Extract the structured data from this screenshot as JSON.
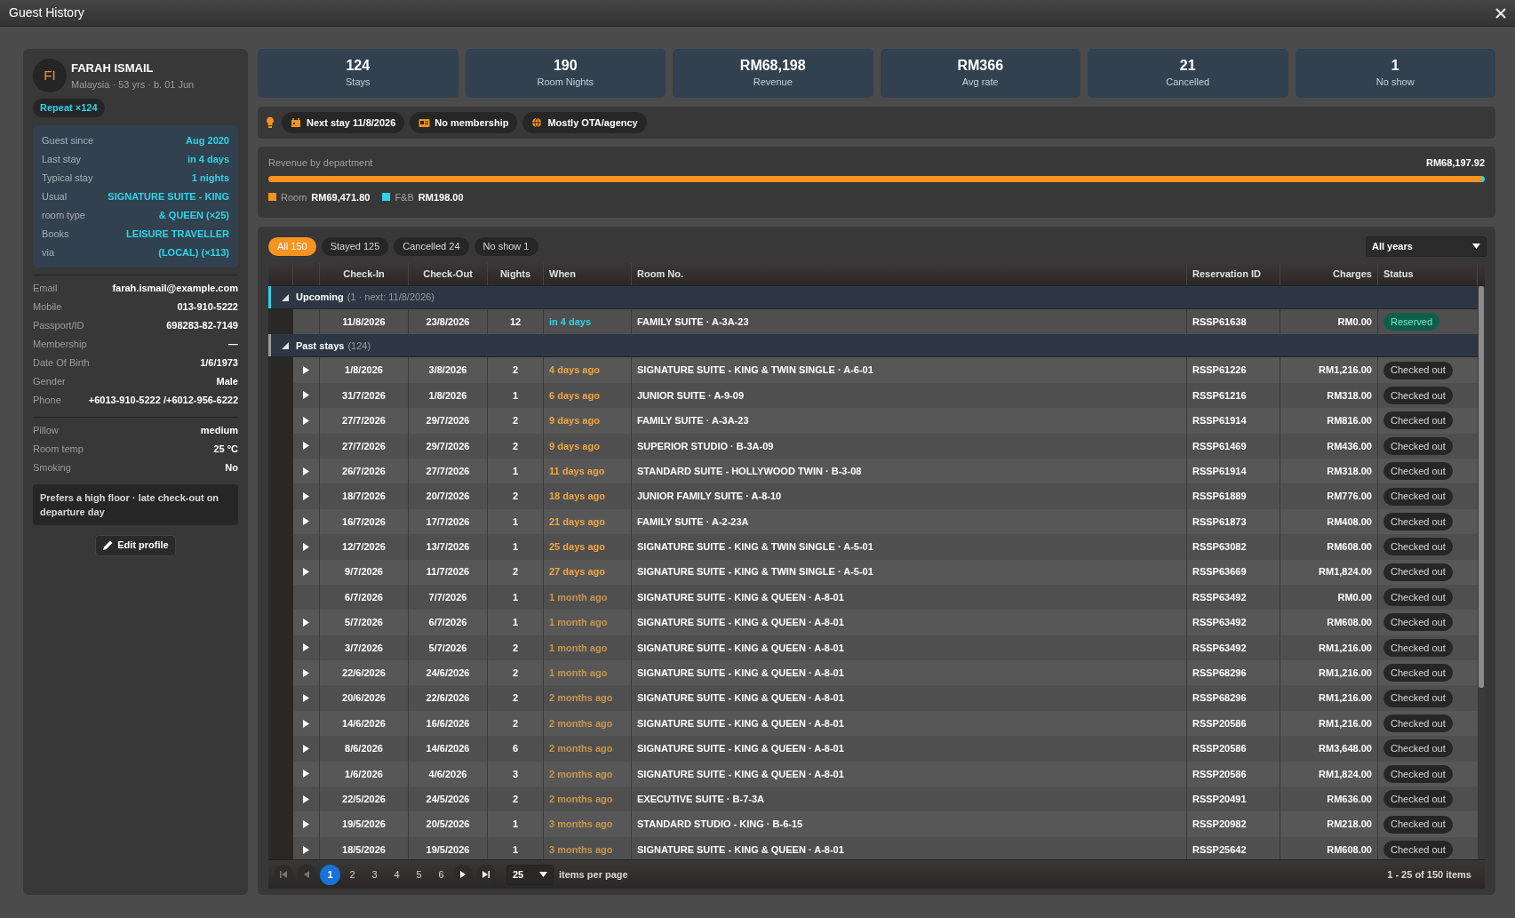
{
  "window": {
    "title": "Guest History"
  },
  "guest": {
    "initials": "FI",
    "name": "FARAH ISMAIL",
    "subtitle": "Malaysia · 53 yrs · b. 01 Jun",
    "badge": "Repeat ×124",
    "summary": [
      {
        "label": "Guest since",
        "value": "Aug 2020"
      },
      {
        "label": "Last stay",
        "value": "in 4 days"
      },
      {
        "label": "Typical stay",
        "value": "1 nights"
      },
      {
        "label": "Usual",
        "value": "SIGNATURE SUITE - KING"
      },
      {
        "label": "room type",
        "value": "& QUEEN (×25)"
      },
      {
        "label": "Books",
        "value": "LEISURE TRAVELLER"
      },
      {
        "label": "via",
        "value": "(LOCAL) (×113)"
      }
    ],
    "contact": [
      {
        "label": "Email",
        "value": "farah.ismail@example.com"
      },
      {
        "label": "Mobile",
        "value": "013-910-5222"
      },
      {
        "label": "Passport/ID",
        "value": "698283-82-7149"
      },
      {
        "label": "Membership",
        "value": "—"
      },
      {
        "label": "Date Of Birth",
        "value": "1/6/1973"
      },
      {
        "label": "Gender",
        "value": "Male"
      },
      {
        "label": "Phone",
        "value": "+6013-910-5222 /+6012-956-6222"
      }
    ],
    "preferences": [
      {
        "label": "Pillow",
        "value": "medium"
      },
      {
        "label": "Room temp",
        "value": "25 °C"
      },
      {
        "label": "Smoking",
        "value": "No"
      }
    ],
    "note": "Prefers a high floor · late check-out on departure day",
    "edit_button": "Edit profile"
  },
  "stats": [
    {
      "value": "124",
      "label": "Stays"
    },
    {
      "value": "190",
      "label": "Room Nights"
    },
    {
      "value": "RM68,198",
      "label": "Revenue"
    },
    {
      "value": "RM366",
      "label": "Avg rate"
    },
    {
      "value": "21",
      "label": "Cancelled"
    },
    {
      "value": "1",
      "label": "No show"
    }
  ],
  "insights": [
    {
      "kind": "calendar",
      "label": "Next stay 11/8/2026"
    },
    {
      "kind": "card",
      "label": "No membership"
    },
    {
      "kind": "globe",
      "label": "Mostly OTA/agency"
    }
  ],
  "revenue": {
    "title": "Revenue by department",
    "total": "RM68,197.92",
    "segments": [
      {
        "label": "Room",
        "value": "RM69,471.80",
        "color": "#f7931e",
        "level": 0.997
      },
      {
        "label": "F&B",
        "value": "RM198.00",
        "color": "#2dd4e6",
        "level": 0.003
      }
    ]
  },
  "filters": [
    {
      "label": "All 150",
      "selected": true
    },
    {
      "label": "Stayed 125",
      "selected": false
    },
    {
      "label": "Cancelled 24",
      "selected": false
    },
    {
      "label": "No show 1",
      "selected": false
    }
  ],
  "year_filter": "All years",
  "table": {
    "columns": [
      {
        "label": "Check-In"
      },
      {
        "label": "Check-Out"
      },
      {
        "label": "Nights"
      },
      {
        "label": "When"
      },
      {
        "label": "Room No."
      },
      {
        "label": "Reservation ID"
      },
      {
        "label": "Charges"
      },
      {
        "label": "Status"
      }
    ],
    "groups": [
      {
        "label": "Upcoming",
        "meta": "(1 · next: 11/8/2026)",
        "expanded": true,
        "color": "#2dd4e6",
        "rows": [
          {
            "expandable": false,
            "check_in": "11/8/2026",
            "check_out": "23/8/2026",
            "nights": "12",
            "when": "in 4 days",
            "color": "#2dd4e6",
            "room": "FAMILY SUITE · A-3A-23",
            "reservation_id": "RSSP61638",
            "charges": "RM0.00",
            "status": "Reserved",
            "kind": "reserved"
          }
        ]
      },
      {
        "label": "Past stays",
        "meta": "(124)",
        "expanded": true,
        "color": "#9a9a9a",
        "rows": [
          {
            "expandable": true,
            "check_in": "1/8/2026",
            "check_out": "3/8/2026",
            "nights": "2",
            "when": "4 days ago",
            "color": "#f0a640",
            "room": "SIGNATURE SUITE - KING & TWIN SINGLE · A-6-01",
            "reservation_id": "RSSP61226",
            "charges": "RM1,216.00",
            "status": "Checked out",
            "kind": "checked_out"
          },
          {
            "expandable": true,
            "check_in": "31/7/2026",
            "check_out": "1/8/2026",
            "nights": "1",
            "when": "6 days ago",
            "color": "#f0a640",
            "room": "JUNIOR SUITE · A-9-09",
            "reservation_id": "RSSP61216",
            "charges": "RM318.00",
            "status": "Checked out",
            "kind": "checked_out"
          },
          {
            "expandable": true,
            "check_in": "27/7/2026",
            "check_out": "29/7/2026",
            "nights": "2",
            "when": "9 days ago",
            "color": "#f0a640",
            "room": "FAMILY SUITE · A-3A-23",
            "reservation_id": "RSSP61914",
            "charges": "RM816.00",
            "status": "Checked out",
            "kind": "checked_out"
          },
          {
            "expandable": true,
            "check_in": "27/7/2026",
            "check_out": "29/7/2026",
            "nights": "2",
            "when": "9 days ago",
            "color": "#f0a640",
            "room": "SUPERIOR STUDIO · B-3A-09",
            "reservation_id": "RSSP61469",
            "charges": "RM436.00",
            "status": "Checked out",
            "kind": "checked_out"
          },
          {
            "expandable": true,
            "check_in": "26/7/2026",
            "check_out": "27/7/2026",
            "nights": "1",
            "when": "11 days ago",
            "color": "#f0a640",
            "room": "STANDARD SUITE - HOLLYWOOD TWIN · B-3-08",
            "reservation_id": "RSSP61914",
            "charges": "RM318.00",
            "status": "Checked out",
            "kind": "checked_out"
          },
          {
            "expandable": true,
            "check_in": "18/7/2026",
            "check_out": "20/7/2026",
            "nights": "2",
            "when": "18 days ago",
            "color": "#f0a640",
            "room": "JUNIOR FAMILY SUITE · A-8-10",
            "reservation_id": "RSSP61889",
            "charges": "RM776.00",
            "status": "Checked out",
            "kind": "checked_out"
          },
          {
            "expandable": true,
            "check_in": "16/7/2026",
            "check_out": "17/7/2026",
            "nights": "1",
            "when": "21 days ago",
            "color": "#f0a640",
            "room": "FAMILY SUITE · A-2-23A",
            "reservation_id": "RSSP61873",
            "charges": "RM408.00",
            "status": "Checked out",
            "kind": "checked_out"
          },
          {
            "expandable": true,
            "check_in": "12/7/2026",
            "check_out": "13/7/2026",
            "nights": "1",
            "when": "25 days ago",
            "color": "#f0a640",
            "room": "SIGNATURE SUITE - KING & TWIN SINGLE · A-5-01",
            "reservation_id": "RSSP63082",
            "charges": "RM608.00",
            "status": "Checked out",
            "kind": "checked_out"
          },
          {
            "expandable": true,
            "check_in": "9/7/2026",
            "check_out": "11/7/2026",
            "nights": "2",
            "when": "27 days ago",
            "color": "#f0a640",
            "room": "SIGNATURE SUITE - KING & TWIN SINGLE · A-5-01",
            "reservation_id": "RSSP63669",
            "charges": "RM1,824.00",
            "status": "Checked out",
            "kind": "checked_out"
          },
          {
            "expandable": false,
            "check_in": "6/7/2026",
            "check_out": "7/7/2026",
            "nights": "1",
            "when": "1 month ago",
            "color": "#c8964e",
            "room": "SIGNATURE SUITE - KING & QUEEN · A-8-01",
            "reservation_id": "RSSP63492",
            "charges": "RM0.00",
            "status": "Checked out",
            "kind": "checked_out"
          },
          {
            "expandable": true,
            "check_in": "5/7/2026",
            "check_out": "6/7/2026",
            "nights": "1",
            "when": "1 month ago",
            "color": "#c8964e",
            "room": "SIGNATURE SUITE - KING & QUEEN · A-8-01",
            "reservation_id": "RSSP63492",
            "charges": "RM608.00",
            "status": "Checked out",
            "kind": "checked_out"
          },
          {
            "expandable": true,
            "check_in": "3/7/2026",
            "check_out": "5/7/2026",
            "nights": "2",
            "when": "1 month ago",
            "color": "#c8964e",
            "room": "SIGNATURE SUITE - KING & QUEEN · A-8-01",
            "reservation_id": "RSSP63492",
            "charges": "RM1,216.00",
            "status": "Checked out",
            "kind": "checked_out"
          },
          {
            "expandable": true,
            "check_in": "22/6/2026",
            "check_out": "24/6/2026",
            "nights": "2",
            "when": "1 month ago",
            "color": "#c8964e",
            "room": "SIGNATURE SUITE - KING & QUEEN · A-8-01",
            "reservation_id": "RSSP68296",
            "charges": "RM1,216.00",
            "status": "Checked out",
            "kind": "checked_out"
          },
          {
            "expandable": true,
            "check_in": "20/6/2026",
            "check_out": "22/6/2026",
            "nights": "2",
            "when": "2 months ago",
            "color": "#c8964e",
            "room": "SIGNATURE SUITE - KING & QUEEN · A-8-01",
            "reservation_id": "RSSP68296",
            "charges": "RM1,216.00",
            "status": "Checked out",
            "kind": "checked_out"
          },
          {
            "expandable": true,
            "check_in": "14/6/2026",
            "check_out": "16/6/2026",
            "nights": "2",
            "when": "2 months ago",
            "color": "#c8964e",
            "room": "SIGNATURE SUITE - KING & QUEEN · A-8-01",
            "reservation_id": "RSSP20586",
            "charges": "RM1,216.00",
            "status": "Checked out",
            "kind": "checked_out"
          },
          {
            "expandable": true,
            "check_in": "8/6/2026",
            "check_out": "14/6/2026",
            "nights": "6",
            "when": "2 months ago",
            "color": "#c8964e",
            "room": "SIGNATURE SUITE - KING & QUEEN · A-8-01",
            "reservation_id": "RSSP20586",
            "charges": "RM3,648.00",
            "status": "Checked out",
            "kind": "checked_out"
          },
          {
            "expandable": true,
            "check_in": "1/6/2026",
            "check_out": "4/6/2026",
            "nights": "3",
            "when": "2 months ago",
            "color": "#c8964e",
            "room": "SIGNATURE SUITE - KING & QUEEN · A-8-01",
            "reservation_id": "RSSP20586",
            "charges": "RM1,824.00",
            "status": "Checked out",
            "kind": "checked_out"
          },
          {
            "expandable": true,
            "check_in": "22/5/2026",
            "check_out": "24/5/2026",
            "nights": "2",
            "when": "2 months ago",
            "color": "#c8964e",
            "room": "EXECUTIVE SUITE · B-7-3A",
            "reservation_id": "RSSP20491",
            "charges": "RM636.00",
            "status": "Checked out",
            "kind": "checked_out"
          },
          {
            "expandable": true,
            "check_in": "19/5/2026",
            "check_out": "20/5/2026",
            "nights": "1",
            "when": "3 months ago",
            "color": "#c8964e",
            "room": "STANDARD STUDIO - KING · B-6-15",
            "reservation_id": "RSSP20982",
            "charges": "RM218.00",
            "status": "Checked out",
            "kind": "checked_out"
          },
          {
            "expandable": true,
            "check_in": "18/5/2026",
            "check_out": "19/5/2026",
            "nights": "1",
            "when": "3 months ago",
            "color": "#c8964e",
            "room": "SIGNATURE SUITE - KING & QUEEN · A-8-01",
            "reservation_id": "RSSP25642",
            "charges": "RM608.00",
            "status": "Checked out",
            "kind": "checked_out"
          }
        ]
      }
    ]
  },
  "pager": {
    "pages": [
      {
        "label": "1",
        "selected": true
      },
      {
        "label": "2",
        "selected": false
      },
      {
        "label": "3",
        "selected": false
      },
      {
        "label": "4",
        "selected": false
      },
      {
        "label": "5",
        "selected": false
      },
      {
        "label": "6",
        "selected": false
      }
    ],
    "page_size": "25",
    "page_size_label": "items per page",
    "summary": "1 - 25 of 150 items"
  }
}
